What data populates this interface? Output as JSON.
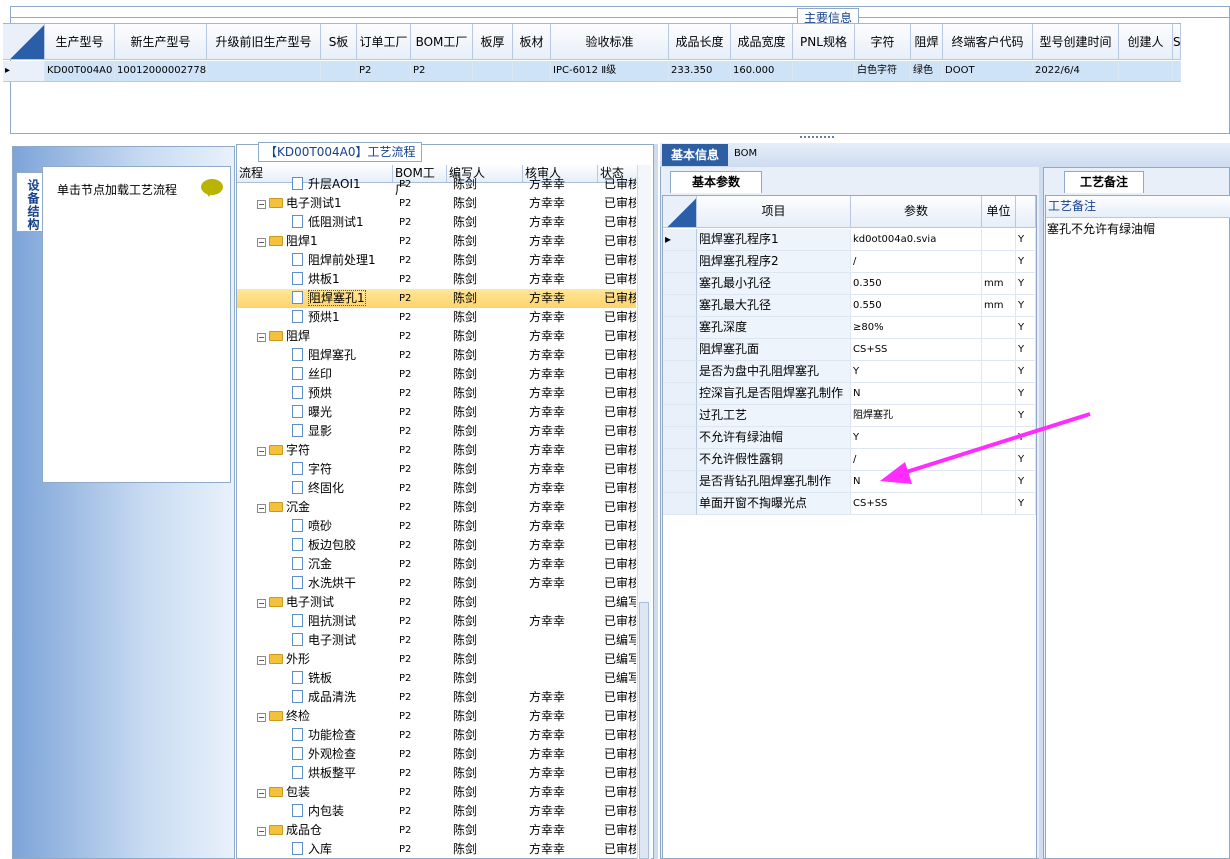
{
  "main": {
    "title": "主要信息",
    "columns": [
      "生产型号",
      "新生产型号",
      "升级前旧生产型号",
      "S板",
      "订单工厂",
      "BOM工厂",
      "板厚",
      "板材",
      "验收标准",
      "成品长度",
      "成品宽度",
      "PNL规格",
      "字符",
      "阻焊",
      "终端客户代码",
      "型号创建时间",
      "创建人",
      "S"
    ],
    "row": [
      "KD00T004A0",
      "10012000002778",
      "",
      "",
      "P2",
      "P2",
      "",
      "",
      "IPC-6012 Ⅱ级",
      "233.350",
      "160.000",
      "",
      "白色字符",
      "绿色",
      "DOOT",
      "2022/6/4",
      "",
      ""
    ]
  },
  "left": {
    "vtab": "设备结构",
    "hint": "单击节点加载工艺流程"
  },
  "flow": {
    "title": "【KD00T004A0】工艺流程",
    "columns": [
      "流程",
      "BOM工厂",
      "编写人",
      "核审人",
      "状态"
    ],
    "rows": [
      {
        "name": "升层AOI1",
        "bom": "P2",
        "writer": "陈剑",
        "auditor": "方幸幸",
        "status": "已审核",
        "type": "doc"
      },
      {
        "name": "电子测试1",
        "bom": "P2",
        "writer": "陈剑",
        "auditor": "方幸幸",
        "status": "已审核",
        "type": "folder"
      },
      {
        "name": "低阻测试1",
        "bom": "P2",
        "writer": "陈剑",
        "auditor": "方幸幸",
        "status": "已审核",
        "type": "doc"
      },
      {
        "name": "阻焊1",
        "bom": "P2",
        "writer": "陈剑",
        "auditor": "方幸幸",
        "status": "已审核",
        "type": "folder"
      },
      {
        "name": "阻焊前处理1",
        "bom": "P2",
        "writer": "陈剑",
        "auditor": "方幸幸",
        "status": "已审核",
        "type": "doc"
      },
      {
        "name": "烘板1",
        "bom": "P2",
        "writer": "陈剑",
        "auditor": "方幸幸",
        "status": "已审核",
        "type": "doc"
      },
      {
        "name": "阻焊塞孔1",
        "bom": "P2",
        "writer": "陈剑",
        "auditor": "方幸幸",
        "status": "已审核",
        "type": "doc"
      },
      {
        "name": "预烘1",
        "bom": "P2",
        "writer": "陈剑",
        "auditor": "方幸幸",
        "status": "已审核",
        "type": "doc"
      },
      {
        "name": "阻焊",
        "bom": "P2",
        "writer": "陈剑",
        "auditor": "方幸幸",
        "status": "已审核",
        "type": "folder"
      },
      {
        "name": "阻焊塞孔",
        "bom": "P2",
        "writer": "陈剑",
        "auditor": "方幸幸",
        "status": "已审核",
        "type": "doc"
      },
      {
        "name": "丝印",
        "bom": "P2",
        "writer": "陈剑",
        "auditor": "方幸幸",
        "status": "已审核",
        "type": "doc"
      },
      {
        "name": "预烘",
        "bom": "P2",
        "writer": "陈剑",
        "auditor": "方幸幸",
        "status": "已审核",
        "type": "doc"
      },
      {
        "name": "曝光",
        "bom": "P2",
        "writer": "陈剑",
        "auditor": "方幸幸",
        "status": "已审核",
        "type": "doc"
      },
      {
        "name": "显影",
        "bom": "P2",
        "writer": "陈剑",
        "auditor": "方幸幸",
        "status": "已审核",
        "type": "doc"
      },
      {
        "name": "字符",
        "bom": "P2",
        "writer": "陈剑",
        "auditor": "方幸幸",
        "status": "已审核",
        "type": "folder"
      },
      {
        "name": "字符",
        "bom": "P2",
        "writer": "陈剑",
        "auditor": "方幸幸",
        "status": "已审核",
        "type": "doc"
      },
      {
        "name": "终固化",
        "bom": "P2",
        "writer": "陈剑",
        "auditor": "方幸幸",
        "status": "已审核",
        "type": "doc"
      },
      {
        "name": "沉金",
        "bom": "P2",
        "writer": "陈剑",
        "auditor": "方幸幸",
        "status": "已审核",
        "type": "folder"
      },
      {
        "name": "喷砂",
        "bom": "P2",
        "writer": "陈剑",
        "auditor": "方幸幸",
        "status": "已审核",
        "type": "doc"
      },
      {
        "name": "板边包胶",
        "bom": "P2",
        "writer": "陈剑",
        "auditor": "方幸幸",
        "status": "已审核",
        "type": "doc"
      },
      {
        "name": "沉金",
        "bom": "P2",
        "writer": "陈剑",
        "auditor": "方幸幸",
        "status": "已审核",
        "type": "doc"
      },
      {
        "name": "水洗烘干",
        "bom": "P2",
        "writer": "陈剑",
        "auditor": "方幸幸",
        "status": "已审核",
        "type": "doc"
      },
      {
        "name": "电子测试",
        "bom": "P2",
        "writer": "陈剑",
        "auditor": "",
        "status": "已编写",
        "type": "folder"
      },
      {
        "name": "阻抗测试",
        "bom": "P2",
        "writer": "陈剑",
        "auditor": "方幸幸",
        "status": "已审核",
        "type": "doc"
      },
      {
        "name": "电子测试",
        "bom": "P2",
        "writer": "陈剑",
        "auditor": "",
        "status": "已编写",
        "type": "doc"
      },
      {
        "name": "外形",
        "bom": "P2",
        "writer": "陈剑",
        "auditor": "",
        "status": "已编写",
        "type": "folder"
      },
      {
        "name": "铣板",
        "bom": "P2",
        "writer": "陈剑",
        "auditor": "",
        "status": "已编写",
        "type": "doc"
      },
      {
        "name": "成品清洗",
        "bom": "P2",
        "writer": "陈剑",
        "auditor": "方幸幸",
        "status": "已审核",
        "type": "doc"
      },
      {
        "name": "终检",
        "bom": "P2",
        "writer": "陈剑",
        "auditor": "方幸幸",
        "status": "已审核",
        "type": "folder"
      },
      {
        "name": "功能检查",
        "bom": "P2",
        "writer": "陈剑",
        "auditor": "方幸幸",
        "status": "已审核",
        "type": "doc"
      },
      {
        "name": "外观检查",
        "bom": "P2",
        "writer": "陈剑",
        "auditor": "方幸幸",
        "status": "已审核",
        "type": "doc"
      },
      {
        "name": "烘板整平",
        "bom": "P2",
        "writer": "陈剑",
        "auditor": "方幸幸",
        "status": "已审核",
        "type": "doc"
      },
      {
        "name": "包装",
        "bom": "P2",
        "writer": "陈剑",
        "auditor": "方幸幸",
        "status": "已审核",
        "type": "folder"
      },
      {
        "name": "内包装",
        "bom": "P2",
        "writer": "陈剑",
        "auditor": "方幸幸",
        "status": "已审核",
        "type": "doc"
      },
      {
        "name": "成品仓",
        "bom": "P2",
        "writer": "陈剑",
        "auditor": "方幸幸",
        "status": "已审核",
        "type": "folder"
      },
      {
        "name": "入库",
        "bom": "P2",
        "writer": "陈剑",
        "auditor": "方幸幸",
        "status": "已审核",
        "type": "doc"
      }
    ],
    "selected_index": 6
  },
  "detail": {
    "tabs": [
      "基本信息",
      "BOM"
    ],
    "subtab": "基本参数",
    "columns": [
      "项目",
      "参数",
      "单位"
    ],
    "rows": [
      {
        "item": "阻焊塞孔程序1",
        "param": "kd0ot004a0.svia",
        "unit": "",
        "flag": "Y"
      },
      {
        "item": "阻焊塞孔程序2",
        "param": "/",
        "unit": "",
        "flag": "Y"
      },
      {
        "item": "塞孔最小孔径",
        "param": "0.350",
        "unit": "mm",
        "flag": "Y"
      },
      {
        "item": "塞孔最大孔径",
        "param": "0.550",
        "unit": "mm",
        "flag": "Y"
      },
      {
        "item": "塞孔深度",
        "param": "≥80%",
        "unit": "",
        "flag": "Y"
      },
      {
        "item": "阻焊塞孔面",
        "param": "CS+SS",
        "unit": "",
        "flag": "Y"
      },
      {
        "item": "是否为盘中孔阻焊塞孔",
        "param": "Y",
        "unit": "",
        "flag": "Y"
      },
      {
        "item": "控深盲孔是否阻焊塞孔制作",
        "param": "N",
        "unit": "",
        "flag": "Y"
      },
      {
        "item": "过孔工艺",
        "param": "阻焊塞孔",
        "unit": "",
        "flag": "Y"
      },
      {
        "item": "不允许有绿油帽",
        "param": "Y",
        "unit": "",
        "flag": "Y"
      },
      {
        "item": "不允许假性露铜",
        "param": "/",
        "unit": "",
        "flag": "Y"
      },
      {
        "item": "是否背钻孔阻焊塞孔制作",
        "param": "N",
        "unit": "",
        "flag": "Y"
      },
      {
        "item": "单面开窗不掏曝光点",
        "param": "CS+SS",
        "unit": "",
        "flag": "Y"
      }
    ]
  },
  "remark": {
    "tab": "工艺备注",
    "header": "工艺备注",
    "text": "塞孔不允许有绿油帽"
  },
  "colors": {
    "accent": "#2f5fa3",
    "selection": "#ffd36b",
    "arrow": "#ff2bff"
  }
}
